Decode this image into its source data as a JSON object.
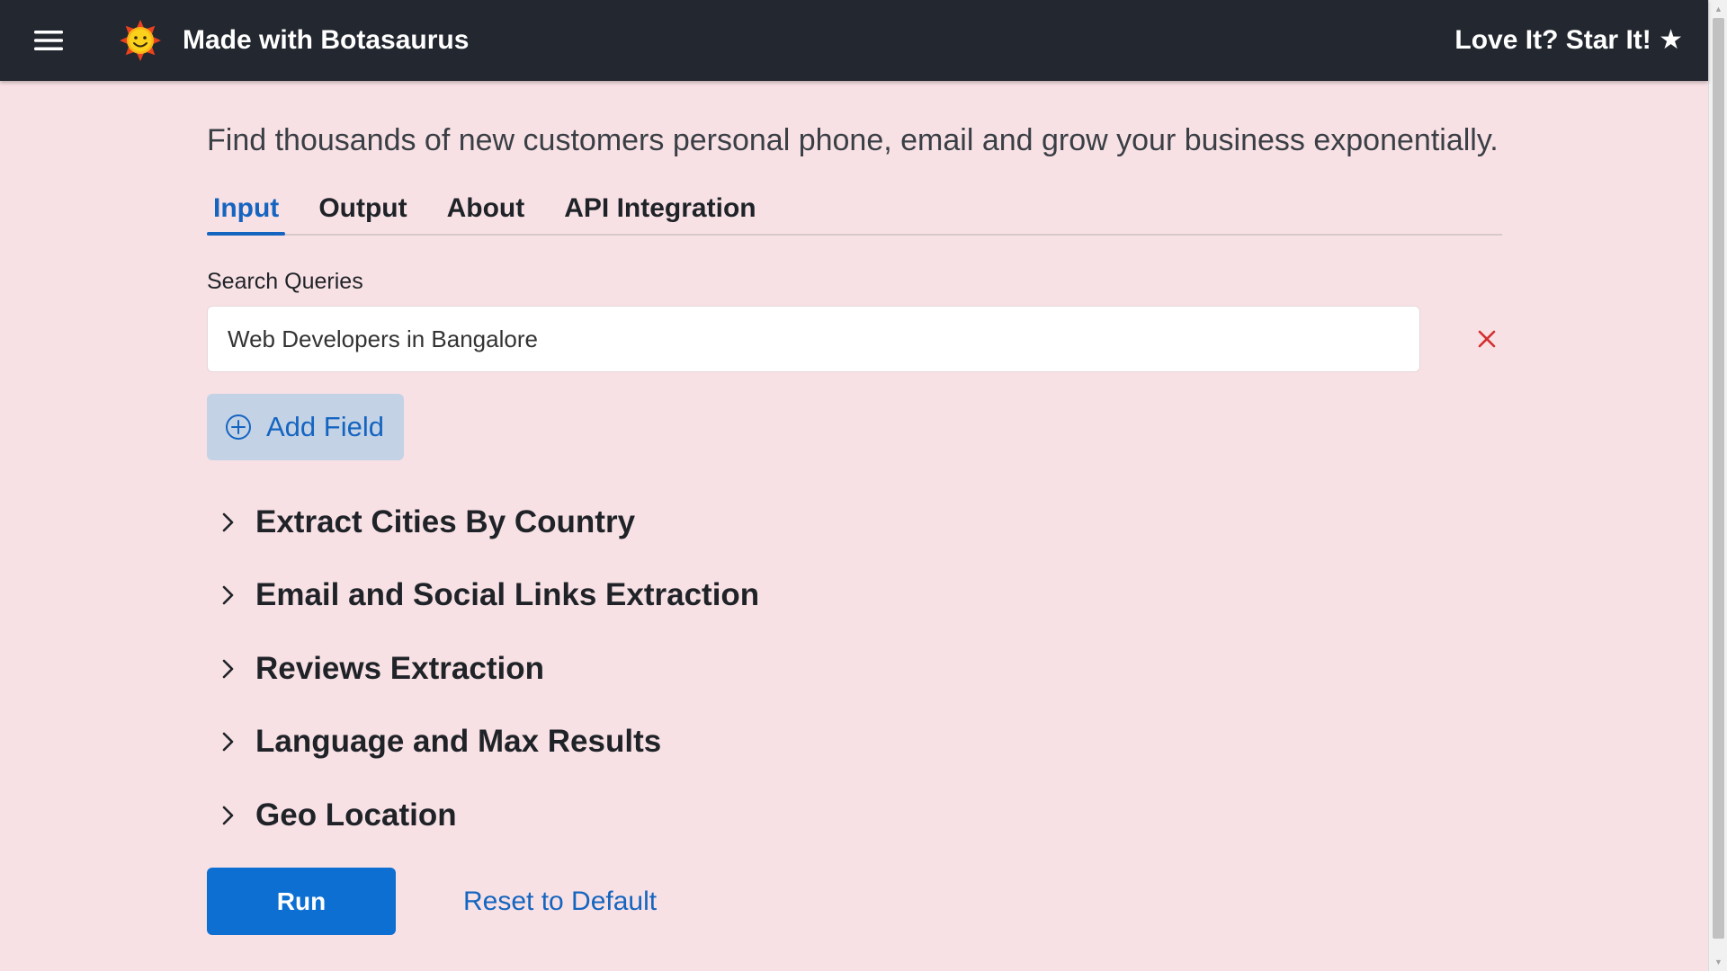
{
  "header": {
    "brand": "Made with Botasaurus",
    "star_link": "Love It? Star It! ★",
    "menu_icon": "hamburger-menu-icon",
    "logo_icon": "sun-smiley-logo-icon",
    "background_color": "#23272f"
  },
  "main": {
    "tagline": "Find thousands of new customers personal phone, email and grow your business exponentially.",
    "tabs": [
      {
        "label": "Input",
        "active": true
      },
      {
        "label": "Output",
        "active": false
      },
      {
        "label": "About",
        "active": false
      },
      {
        "label": "API Integration",
        "active": false
      }
    ],
    "search_queries": {
      "label": "Search Queries",
      "value": "Web Developers in Bangalore",
      "clear_icon": "close-x-icon"
    },
    "add_field_label": "Add Field",
    "sections": [
      {
        "title": "Extract Cities By Country"
      },
      {
        "title": "Email and Social Links Extraction"
      },
      {
        "title": "Reviews Extraction"
      },
      {
        "title": "Language and Max Results"
      },
      {
        "title": "Geo Location"
      }
    ],
    "run_label": "Run",
    "reset_label": "Reset to Default"
  },
  "colors": {
    "page_background": "#f8e1e5",
    "accent": "#1565c0",
    "run_button": "#0d6fd1",
    "clear_icon": "#d32f2f"
  }
}
